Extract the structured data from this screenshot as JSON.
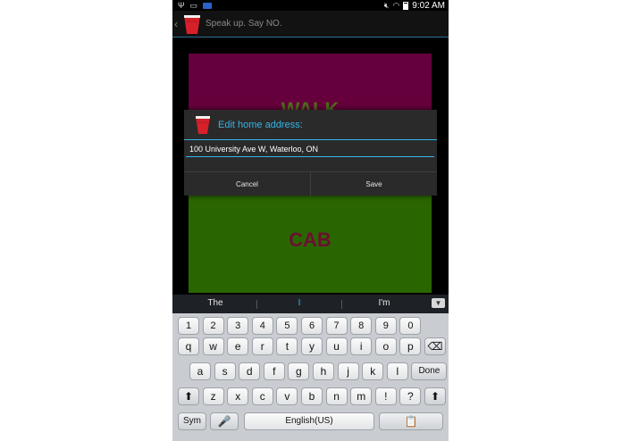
{
  "status_bar": {
    "time": "9:02 AM",
    "left_icons": [
      "usb-icon",
      "keyboard-icon",
      "notification-icon"
    ],
    "right_icons": [
      "mute-icon",
      "wifi-icon",
      "battery-icon"
    ]
  },
  "action_bar": {
    "title": "Speak up. Say NO.",
    "back_glyph": "‹",
    "app_icon": "red-cup-icon"
  },
  "main": {
    "walk_label": "WALK",
    "cab_label": "CAB",
    "walk_color": "#66003c",
    "cab_color": "#2a6600"
  },
  "dialog": {
    "title": "Edit home address:",
    "input_value": "100 University Ave W, Waterloo, ON",
    "cancel_label": "Cancel",
    "save_label": "Save",
    "accent_color": "#33b5e5"
  },
  "keyboard": {
    "suggestions": [
      "The",
      "I",
      "I'm"
    ],
    "row_numbers": [
      "1",
      "2",
      "3",
      "4",
      "5",
      "6",
      "7",
      "8",
      "9",
      "0"
    ],
    "row_1": [
      "q",
      "w",
      "e",
      "r",
      "t",
      "y",
      "u",
      "i",
      "o",
      "p"
    ],
    "row_2": [
      "a",
      "s",
      "d",
      "f",
      "g",
      "h",
      "j",
      "k",
      "l"
    ],
    "row_3": [
      "z",
      "x",
      "c",
      "v",
      "b",
      "n",
      "m",
      "!",
      "?"
    ],
    "punct_secondary": [
      ",",
      "."
    ],
    "done_label": "Done",
    "sym_label": "Sym",
    "space_label": "English(US)",
    "backspace_glyph": "⌫",
    "shift_glyph": "⬆",
    "mic_glyph": "🎤",
    "clipboard_glyph": "📋"
  }
}
